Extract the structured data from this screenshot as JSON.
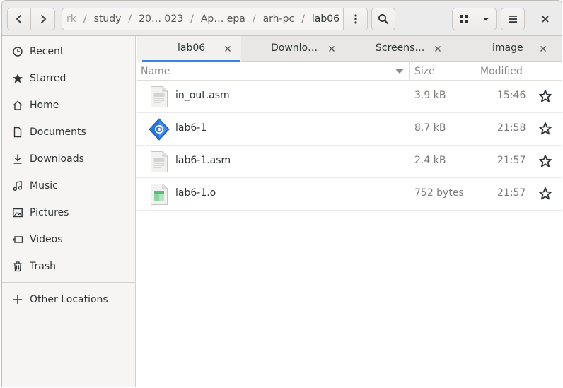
{
  "pathbar": {
    "crumbs": [
      "rk",
      "study",
      "20… 023",
      "Ap… epa",
      "arh-pc",
      "lab06"
    ],
    "separator": "/"
  },
  "icons": {
    "back": "go-previous-icon",
    "forward": "go-next-icon",
    "path_menu": "vertical-dots-icon",
    "search": "search-icon",
    "view": "grid-view-icon",
    "view_options": "chevron-down-icon",
    "menu": "hamburger-menu-icon",
    "close": "close-icon"
  },
  "sidebar": {
    "items": [
      {
        "label": "Recent",
        "icon": "clock-icon"
      },
      {
        "label": "Starred",
        "icon": "star-icon"
      },
      {
        "label": "Home",
        "icon": "home-icon"
      },
      {
        "label": "Documents",
        "icon": "document-icon"
      },
      {
        "label": "Downloads",
        "icon": "download-icon"
      },
      {
        "label": "Music",
        "icon": "music-icon"
      },
      {
        "label": "Pictures",
        "icon": "picture-icon"
      },
      {
        "label": "Videos",
        "icon": "video-icon"
      },
      {
        "label": "Trash",
        "icon": "trash-icon"
      }
    ],
    "other_locations": {
      "label": "Other Locations",
      "icon": "plus-icon"
    }
  },
  "tabs": [
    {
      "label": "lab06",
      "active": true
    },
    {
      "label": "Downlo…",
      "active": false
    },
    {
      "label": "Screens…",
      "active": false
    },
    {
      "label": "image",
      "active": false
    }
  ],
  "columns": {
    "name": "Name",
    "size": "Size",
    "modified": "Modified"
  },
  "files": [
    {
      "name": "in_out.asm",
      "size": "3.9 kB",
      "modified": "15:46",
      "icon": "text-file-icon"
    },
    {
      "name": "lab6-1",
      "size": "8.7 kB",
      "modified": "21:58",
      "icon": "executable-icon"
    },
    {
      "name": "lab6-1.asm",
      "size": "2.4 kB",
      "modified": "21:57",
      "icon": "text-file-icon"
    },
    {
      "name": "lab6-1.o",
      "size": "752 bytes",
      "modified": "21:57",
      "icon": "object-file-icon"
    }
  ],
  "colors": {
    "accent": "#3584e4",
    "headerbar": "#ebebeb",
    "sidebar": "#f6f5f4"
  }
}
